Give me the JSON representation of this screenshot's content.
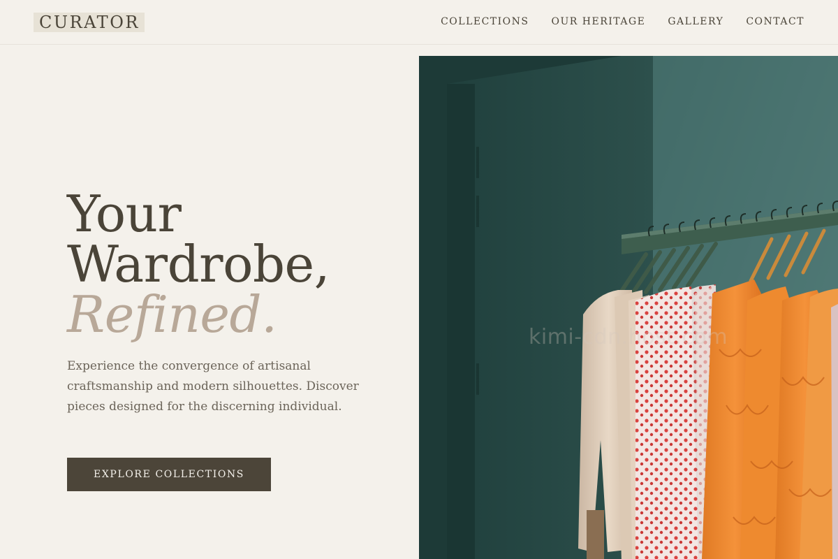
{
  "header": {
    "logo": "CURATOR",
    "nav": [
      "COLLECTIONS",
      "OUR HERITAGE",
      "GALLERY",
      "CONTACT"
    ]
  },
  "hero": {
    "title_line1": "Your",
    "title_line2": "Wardrobe,",
    "title_accent": "Refined.",
    "description": "Experience the convergence of artisanal craftsmanship and modern silhouettes. Discover pieces designed for the discerning individual.",
    "cta_label": "EXPLORE COLLECTIONS"
  },
  "image": {
    "subject": "clothing rack with garments in a teal room",
    "watermark": "kimi-cdn.host.com"
  },
  "colors": {
    "background": "#f4f1eb",
    "text": "#4a4438",
    "accent": "#b8a898",
    "button": "#4c4539",
    "photo_wall": "#2f5552"
  }
}
